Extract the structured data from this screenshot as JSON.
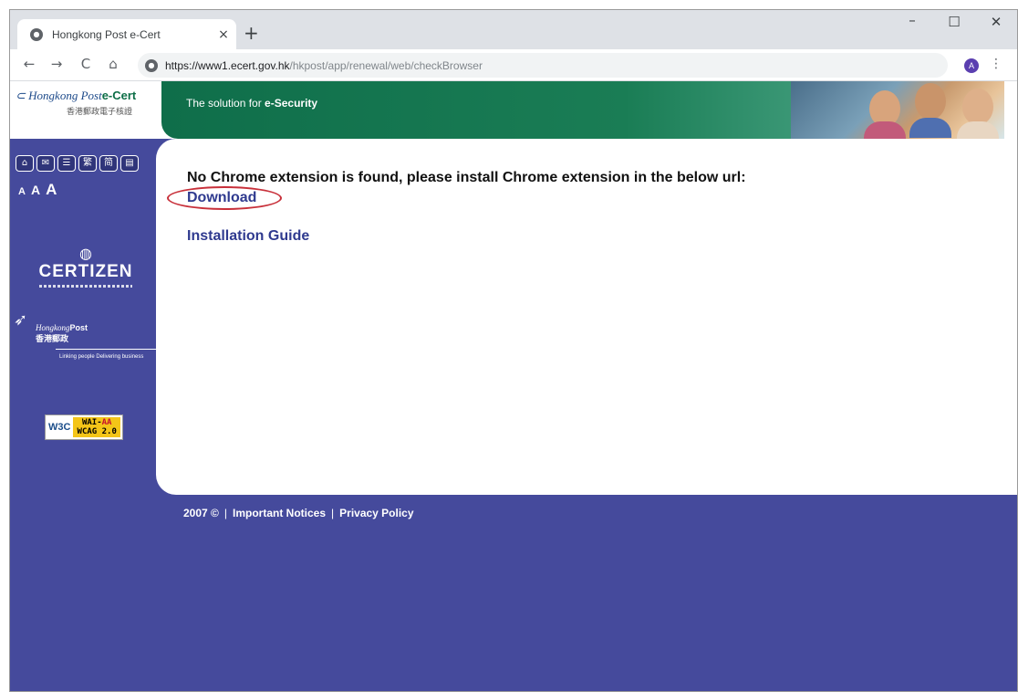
{
  "browser": {
    "tab_title": "Hongkong Post e-Cert",
    "tab_close": "×",
    "new_tab": "+",
    "minimize": "–",
    "maximize": "☐",
    "close": "✕",
    "back": "←",
    "forward": "→",
    "reload": "C",
    "home": "⌂",
    "url_host": "https://www1.ecert.gov.hk",
    "url_path": "/hkpost/app/renewal/web/checkBrowser",
    "profile_initial": "A",
    "menu": "⋮"
  },
  "header": {
    "logo_script": "Hongkong Post",
    "logo_brand": "e-Cert",
    "logo_chinese": "香港郵政電子核證",
    "slogan_prefix": "The solution for ",
    "slogan_emphasis": "e-Security"
  },
  "sidebar": {
    "icons": [
      {
        "name": "home-icon",
        "glyph": "⌂"
      },
      {
        "name": "mail-icon",
        "glyph": "✉"
      },
      {
        "name": "sitemap-icon",
        "glyph": "☰"
      },
      {
        "name": "traditional-chinese-icon",
        "glyph": "繁"
      },
      {
        "name": "simplified-chinese-icon",
        "glyph": "简"
      },
      {
        "name": "print-icon",
        "glyph": "▤"
      }
    ],
    "font_sizes": [
      "A",
      "A",
      "A"
    ],
    "certizen": {
      "name": "CERTIZEN"
    },
    "hkpost": {
      "script": "Hongkong",
      "bold": "Post",
      "chinese": "香港郵政",
      "tagline": "Linking people Delivering business"
    },
    "w3c": {
      "logo": "W3C",
      "line1_prefix": "WAI-",
      "line1_aa": "AA",
      "line2": "WCAG 2.0"
    }
  },
  "content": {
    "message": "No Chrome extension is found, please install Chrome extension in the below url:",
    "download_label": "Download",
    "guide_label": "Installation Guide"
  },
  "footer": {
    "copyright": "2007 ©",
    "notices": "Important Notices",
    "privacy": "Privacy Policy",
    "separator": "|"
  },
  "colors": {
    "page_background": "#454a9c",
    "banner_green": "#0f6e4a",
    "link_color": "#2f3a8f",
    "highlight_red": "#c8303a"
  }
}
